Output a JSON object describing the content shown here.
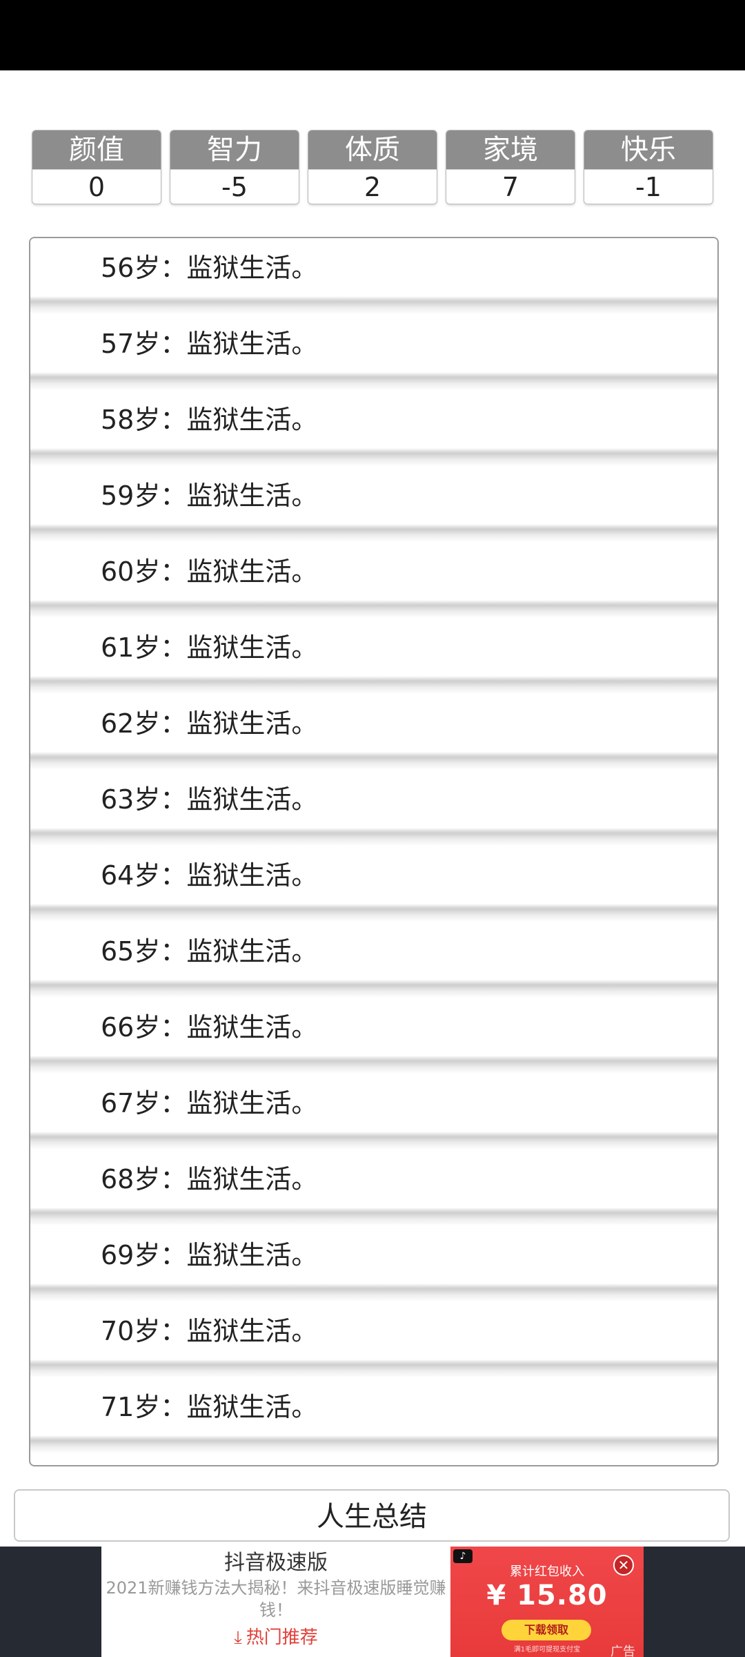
{
  "stats": [
    {
      "label": "颜值",
      "value": "0"
    },
    {
      "label": "智力",
      "value": "-5"
    },
    {
      "label": "体质",
      "value": "2"
    },
    {
      "label": "家境",
      "value": "7"
    },
    {
      "label": "快乐",
      "value": "-1"
    }
  ],
  "log": [
    "56岁：监狱生活。",
    "57岁：监狱生活。",
    "58岁：监狱生活。",
    "59岁：监狱生活。",
    "60岁：监狱生活。",
    "61岁：监狱生活。",
    "62岁：监狱生活。",
    "63岁：监狱生活。",
    "64岁：监狱生活。",
    "65岁：监狱生活。",
    "66岁：监狱生活。",
    "67岁：监狱生活。",
    "68岁：监狱生活。",
    "69岁：监狱生活。",
    "70岁：监狱生活。",
    "71岁：监狱生活。"
  ],
  "summary_label": "人生总结",
  "ad": {
    "title": "抖音极速版",
    "description": "2021新赚钱方法大揭秘！来抖音极速版睡觉赚钱！",
    "cta": "热门推荐",
    "income_label": "累计红包收入",
    "amount": "¥ 15.80",
    "download_label": "下载领取",
    "note": "满1毛即可提现支付宝",
    "tag": "广告",
    "accent_color": "#e83a3a"
  }
}
